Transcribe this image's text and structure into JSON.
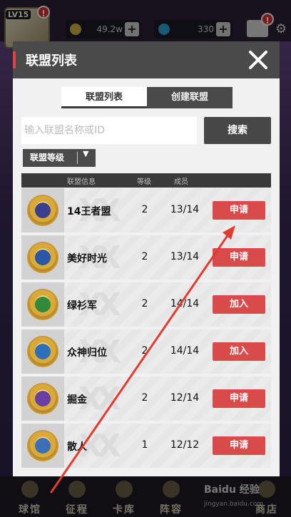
{
  "background": {
    "level_badge": "LV15",
    "alert": "!",
    "resources": [
      {
        "value": "49.2w",
        "icon": "coin-icon",
        "color": "#d8b24a"
      },
      {
        "value": "330",
        "icon": "diamond-icon",
        "color": "#2aa2d9"
      }
    ],
    "nav": [
      {
        "label": "球馆",
        "icon": "arena-icon"
      },
      {
        "label": "征程",
        "icon": "journey-icon"
      },
      {
        "label": "卡库",
        "icon": "cards-icon"
      },
      {
        "label": "阵容",
        "icon": "lineup-icon"
      },
      {
        "label": "商店",
        "icon": "shop-icon"
      }
    ],
    "watermark": {
      "brand": "Baidu 经验",
      "url": "jingyan.baidu.com"
    }
  },
  "dialog": {
    "title": "联盟列表",
    "tabs": [
      {
        "label": "联盟列表",
        "active": true
      },
      {
        "label": "创建联盟",
        "active": false
      }
    ],
    "search": {
      "placeholder": "输入联盟名称或ID",
      "value": "",
      "button": "搜索"
    },
    "filter": {
      "label": "联盟等级"
    },
    "columns": [
      "联盟信息",
      "等级",
      "成员"
    ],
    "rows": [
      {
        "name": "14王者盟",
        "level": "2",
        "members": "13/14",
        "action": "申请",
        "emblem_color": "#3a3f8f"
      },
      {
        "name": "美好时光",
        "level": "2",
        "members": "13/14",
        "action": "申请",
        "emblem_color": "#2c57a6"
      },
      {
        "name": "绿衫军",
        "level": "2",
        "members": "14/14",
        "action": "加入",
        "emblem_color": "#2f8a3a"
      },
      {
        "name": "众神归位",
        "level": "2",
        "members": "14/14",
        "action": "加入",
        "emblem_color": "#2d6fb9"
      },
      {
        "name": "掘金",
        "level": "2",
        "members": "12/14",
        "action": "申请",
        "emblem_color": "#6a3fa3"
      },
      {
        "name": "散人",
        "level": "1",
        "members": "12/12",
        "action": "申请",
        "emblem_color": "#3b6fb8"
      }
    ],
    "colors": {
      "accent": "#e04343",
      "button_red": "#d94b4b",
      "header_dark": "#4a4a4a"
    }
  }
}
